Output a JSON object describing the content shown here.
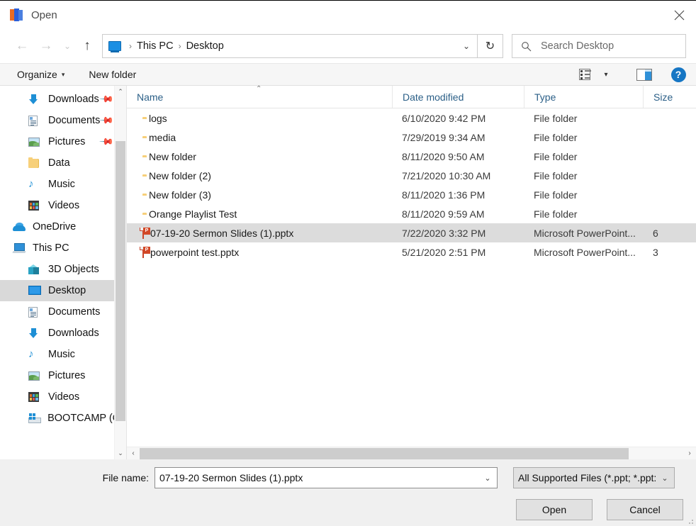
{
  "window": {
    "title": "Open",
    "app_icon": "powerpoint-icon",
    "close_label": "✕"
  },
  "nav": {
    "back_label": "←",
    "forward_label": "→",
    "recent_label": "⌄",
    "up_label": "↑",
    "breadcrumb": {
      "icon": "this-pc-icon",
      "separator": "›",
      "items": [
        "This PC",
        "Desktop"
      ],
      "dropdown_caret": "⌄"
    },
    "refresh_label": "↻",
    "search": {
      "icon": "search-icon",
      "placeholder": "Search Desktop",
      "value": ""
    }
  },
  "toolbar": {
    "organize_label": "Organize",
    "organize_caret": "▾",
    "new_folder_label": "New folder",
    "view_caret": "▾",
    "icons": [
      "view-options-icon",
      "preview-pane-icon",
      "help-icon"
    ],
    "help_glyph": "?"
  },
  "sidebar": {
    "scroll_up": "⌃",
    "scroll_down": "⌄",
    "items": [
      {
        "label": "Downloads",
        "icon": "download-icon",
        "indent": 1,
        "pinned": true,
        "selected": false
      },
      {
        "label": "Documents",
        "icon": "document-icon",
        "indent": 1,
        "pinned": true,
        "selected": false
      },
      {
        "label": "Pictures",
        "icon": "picture-icon",
        "indent": 1,
        "pinned": true,
        "selected": false
      },
      {
        "label": "Data",
        "icon": "folder-icon",
        "indent": 1,
        "pinned": false,
        "selected": false
      },
      {
        "label": "Music",
        "icon": "music-icon",
        "indent": 1,
        "pinned": false,
        "selected": false
      },
      {
        "label": "Videos",
        "icon": "video-icon",
        "indent": 1,
        "pinned": false,
        "selected": false
      },
      {
        "label": "OneDrive",
        "icon": "cloud-icon",
        "indent": 0,
        "pinned": false,
        "selected": false
      },
      {
        "label": "This PC",
        "icon": "computer-icon",
        "indent": 0,
        "pinned": false,
        "selected": false
      },
      {
        "label": "3D Objects",
        "icon": "3d-objects-icon",
        "indent": 1,
        "pinned": false,
        "selected": false
      },
      {
        "label": "Desktop",
        "icon": "desktop-icon",
        "indent": 1,
        "pinned": false,
        "selected": true
      },
      {
        "label": "Documents",
        "icon": "document-icon",
        "indent": 1,
        "pinned": false,
        "selected": false
      },
      {
        "label": "Downloads",
        "icon": "download-icon",
        "indent": 1,
        "pinned": false,
        "selected": false
      },
      {
        "label": "Music",
        "icon": "music-icon",
        "indent": 1,
        "pinned": false,
        "selected": false
      },
      {
        "label": "Pictures",
        "icon": "picture-icon",
        "indent": 1,
        "pinned": false,
        "selected": false
      },
      {
        "label": "Videos",
        "icon": "video-icon",
        "indent": 1,
        "pinned": false,
        "selected": false
      },
      {
        "label": "BOOTCAMP (C:)",
        "icon": "drive-icon",
        "indent": 1,
        "pinned": false,
        "selected": false
      }
    ]
  },
  "filelist": {
    "columns": [
      "Name",
      "Date modified",
      "Type",
      "Size"
    ],
    "sort_indicator": "⌃",
    "rows": [
      {
        "name": "logs",
        "date": "6/10/2020 9:42 PM",
        "type": "File folder",
        "size": "",
        "icon": "folder-icon",
        "selected": false
      },
      {
        "name": "media",
        "date": "7/29/2019 9:34 AM",
        "type": "File folder",
        "size": "",
        "icon": "folder-icon",
        "selected": false
      },
      {
        "name": "New folder",
        "date": "8/11/2020 9:50 AM",
        "type": "File folder",
        "size": "",
        "icon": "folder-icon",
        "selected": false
      },
      {
        "name": "New folder (2)",
        "date": "7/21/2020 10:30 AM",
        "type": "File folder",
        "size": "",
        "icon": "folder-icon",
        "selected": false
      },
      {
        "name": "New folder (3)",
        "date": "8/11/2020 1:36 PM",
        "type": "File folder",
        "size": "",
        "icon": "folder-icon",
        "selected": false
      },
      {
        "name": "Orange Playlist Test",
        "date": "8/11/2020 9:59 AM",
        "type": "File folder",
        "size": "",
        "icon": "folder-icon",
        "selected": false
      },
      {
        "name": "07-19-20 Sermon Slides (1).pptx",
        "date": "7/22/2020 3:32 PM",
        "type": "Microsoft PowerPoint...",
        "size": "6",
        "icon": "powerpoint-icon",
        "selected": true
      },
      {
        "name": "powerpoint test.pptx",
        "date": "5/21/2020 2:51 PM",
        "type": "Microsoft PowerPoint...",
        "size": "3",
        "icon": "powerpoint-icon",
        "selected": false
      }
    ],
    "hscroll": {
      "left_arrow": "‹",
      "right_arrow": "›"
    }
  },
  "footer": {
    "filename_label": "File name:",
    "filename_value": "07-19-20 Sermon Slides (1).pptx",
    "filename_caret": "⌄",
    "filter_value": "All Supported Files (*.ppt; *.ppt:",
    "filter_caret": "⌄",
    "open_label": "Open",
    "cancel_label": "Cancel"
  },
  "colors": {
    "accent": "#1e8fd5",
    "selection": "#dcdcdc",
    "header_text": "#2b5f87",
    "folder": "#f7d07a",
    "powerpoint": "#d24726"
  }
}
